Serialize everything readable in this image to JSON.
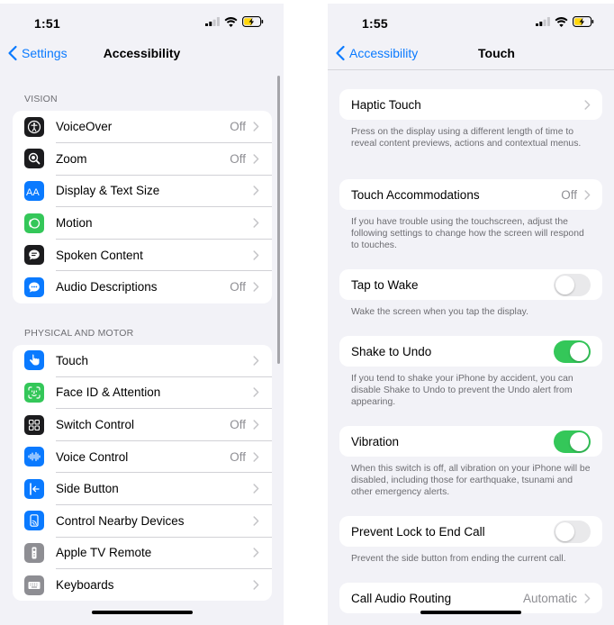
{
  "left": {
    "status": {
      "time": "1:51"
    },
    "nav": {
      "back_label": "Settings",
      "title": "Accessibility"
    },
    "vision": {
      "header": "VISION",
      "items": [
        {
          "label": "VoiceOver",
          "value": "Off",
          "icon": "voiceover-icon",
          "color": "#1c1c1e"
        },
        {
          "label": "Zoom",
          "value": "Off",
          "icon": "zoom-icon",
          "color": "#1c1c1e"
        },
        {
          "label": "Display & Text Size",
          "value": "",
          "icon": "text-size-icon",
          "color": "#0a7aff"
        },
        {
          "label": "Motion",
          "value": "",
          "icon": "motion-icon",
          "color": "#34c759"
        },
        {
          "label": "Spoken Content",
          "value": "",
          "icon": "spoken-content-icon",
          "color": "#1c1c1e"
        },
        {
          "label": "Audio Descriptions",
          "value": "Off",
          "icon": "audio-descriptions-icon",
          "color": "#0a7aff"
        }
      ]
    },
    "physical": {
      "header": "PHYSICAL AND MOTOR",
      "items": [
        {
          "label": "Touch",
          "value": "",
          "icon": "touch-icon",
          "color": "#0a7aff"
        },
        {
          "label": "Face ID & Attention",
          "value": "",
          "icon": "face-id-icon",
          "color": "#34c759"
        },
        {
          "label": "Switch Control",
          "value": "Off",
          "icon": "switch-control-icon",
          "color": "#1c1c1e"
        },
        {
          "label": "Voice Control",
          "value": "Off",
          "icon": "voice-control-icon",
          "color": "#0a7aff"
        },
        {
          "label": "Side Button",
          "value": "",
          "icon": "side-button-icon",
          "color": "#0a7aff"
        },
        {
          "label": "Control Nearby Devices",
          "value": "",
          "icon": "nearby-devices-icon",
          "color": "#0a7aff"
        },
        {
          "label": "Apple TV Remote",
          "value": "",
          "icon": "tv-remote-icon",
          "color": "#8e8e93"
        },
        {
          "label": "Keyboards",
          "value": "",
          "icon": "keyboard-icon",
          "color": "#8e8e93"
        }
      ]
    }
  },
  "right": {
    "status": {
      "time": "1:55"
    },
    "nav": {
      "back_label": "Accessibility",
      "title": "Touch"
    },
    "haptic": {
      "label": "Haptic Touch",
      "footer": "Press on the display using a different length of time to reveal content previews, actions and contextual menus."
    },
    "accommodations": {
      "label": "Touch Accommodations",
      "value": "Off",
      "footer": "If you have trouble using the touchscreen, adjust the following settings to change how the screen will respond to touches."
    },
    "tap_to_wake": {
      "label": "Tap to Wake",
      "on": false,
      "footer": "Wake the screen when you tap the display."
    },
    "shake_to_undo": {
      "label": "Shake to Undo",
      "on": true,
      "footer": "If you tend to shake your iPhone by accident, you can disable Shake to Undo to prevent the Undo alert from appearing."
    },
    "vibration": {
      "label": "Vibration",
      "on": true,
      "footer": "When this switch is off, all vibration on your iPhone will be disabled, including those for earthquake, tsunami and other emergency alerts."
    },
    "prevent_lock": {
      "label": "Prevent Lock to End Call",
      "on": false,
      "footer": "Prevent the side button from ending the current call."
    },
    "call_audio": {
      "label": "Call Audio Routing",
      "value": "Automatic"
    }
  },
  "colors": {
    "accent": "#0a7aff",
    "toggle_on": "#34c759",
    "toggle_off": "#e9e9eb",
    "background": "#f2f2f7"
  }
}
